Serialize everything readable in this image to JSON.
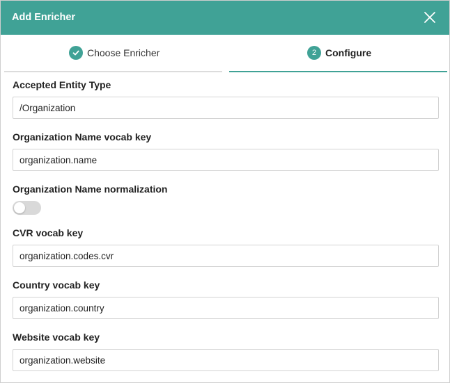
{
  "dialog": {
    "title": "Add Enricher",
    "close_icon": "close-icon",
    "accent_color": "#40a296"
  },
  "steps": [
    {
      "label": "Choose Enricher",
      "state": "completed",
      "indicator": "check-icon"
    },
    {
      "label": "Configure",
      "state": "active",
      "indicator": "2"
    }
  ],
  "fields": {
    "entity_type": {
      "label": "Accepted Entity Type",
      "value": "/Organization"
    },
    "org_name_key": {
      "label": "Organization Name vocab key",
      "value": "organization.name"
    },
    "org_name_normalization": {
      "label": "Organization Name normalization",
      "enabled": false
    },
    "cvr_key": {
      "label": "CVR vocab key",
      "value": "organization.codes.cvr"
    },
    "country_key": {
      "label": "Country vocab key",
      "value": "organization.country"
    },
    "website_key": {
      "label": "Website vocab key",
      "value": "organization.website"
    }
  }
}
